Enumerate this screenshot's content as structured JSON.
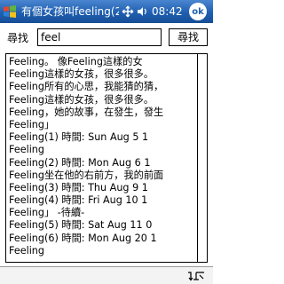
{
  "titlebar": {
    "title": "有個女孩叫feeling(2",
    "time": "08:42",
    "ok_label": "ok",
    "icons": [
      "windows-start-icon",
      "connectivity-icon",
      "volume-icon"
    ],
    "brand_color": "#1f5fb0"
  },
  "search": {
    "label": "尋找",
    "value": "feel",
    "button_label": "尋找"
  },
  "results": {
    "lines": [
      "Feeling。  像Feeling這樣的女",
      "Feeling這樣的女孩，很多很多。",
      "Feeling所有的心思，我能猜的猜，",
      "Feeling這樣的女孩，很多很多。",
      "Feeling，她的故事，在發生，發生",
      "Feeling」",
      "Feeling(1) 時間: Sun Aug  5 1",
      "Feeling",
      "Feeling(2) 時間: Mon Aug  6 1",
      "Feeling坐在他的右前方，我的前面",
      "Feeling(3) 時間: Thu Aug  9 1",
      "Feeling(4) 時間: Fri Aug 10 1",
      "Feeling」    -待續-",
      "Feeling(5) 時間: Sat Aug 11 0",
      "Feeling(6) 時間: Mon Aug 20 1",
      "Feeling"
    ]
  },
  "bottombar": {
    "sip_icon": "keyboard-sip-icon"
  }
}
